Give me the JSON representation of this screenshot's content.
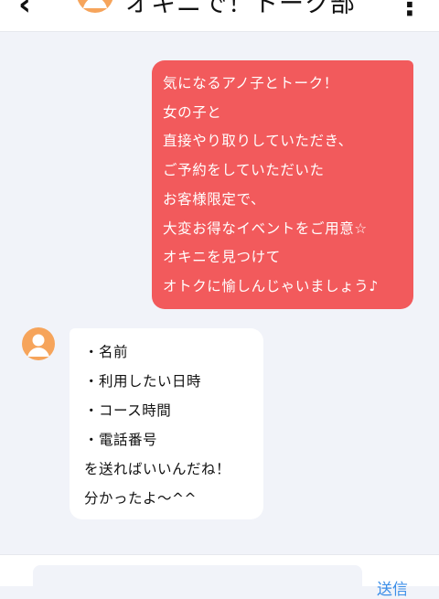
{
  "header": {
    "back_icon": "chevron-left-icon",
    "title": "オキニで！トーク部",
    "menu_icon": "more-vertical-icon"
  },
  "messages": [
    {
      "side": "right",
      "color": "#f25a5c",
      "lines": [
        "気になるアノ子とトーク！",
        "女の子と",
        "直接やり取りしていただき、",
        "ご予約をしていただいた",
        "お客様限定で、",
        "大変お得なイベントをご用意☆",
        "オキニを見つけて",
        "オトクに愉しんじゃいましょう♪"
      ]
    },
    {
      "side": "left",
      "avatar_icon": "user-avatar-icon",
      "lines": [
        "・名前",
        "・利用したい日時",
        "・コース時間",
        "・電話番号",
        "を送ればいいんだね！",
        "分かったよ〜^^"
      ]
    }
  ],
  "footer": {
    "send_label": "送信",
    "accent": "#3b8ee8"
  }
}
